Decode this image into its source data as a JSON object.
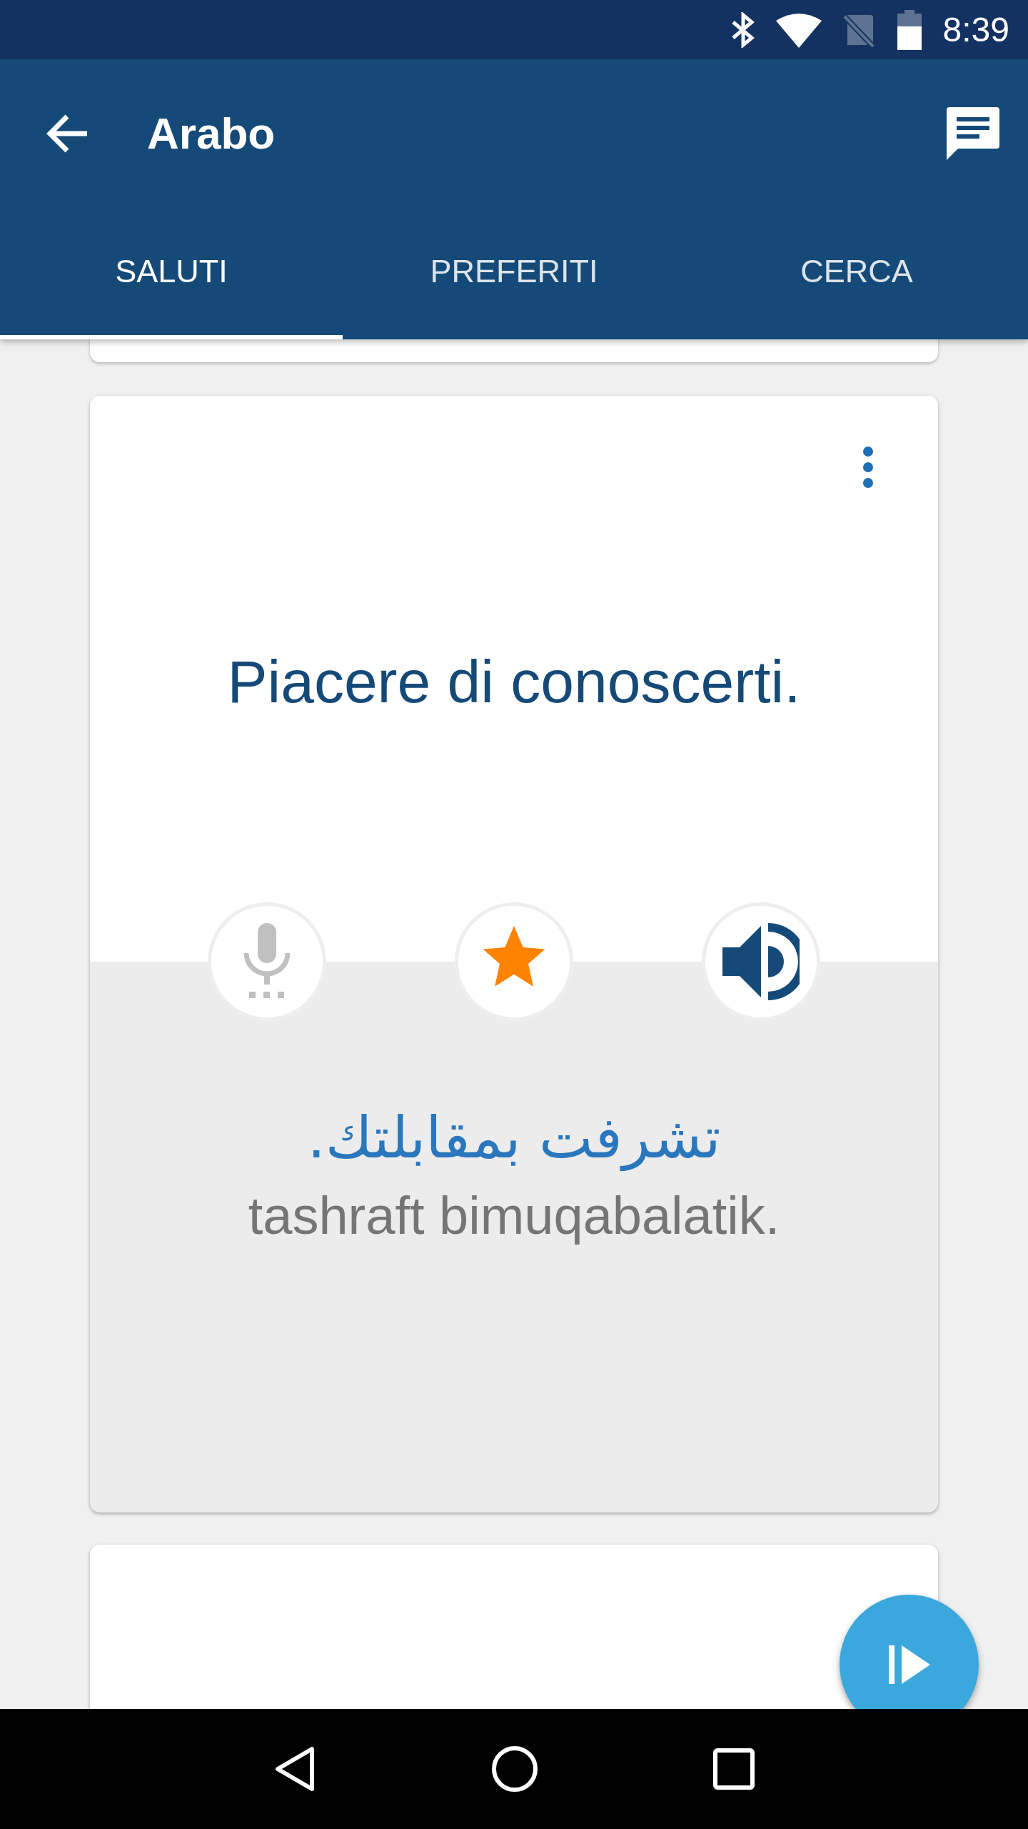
{
  "status_bar": {
    "time": "8:39"
  },
  "app_bar": {
    "title": "Arabo"
  },
  "tabs": [
    {
      "label": "SALUTI",
      "selected": true
    },
    {
      "label": "PREFERITI",
      "selected": false
    },
    {
      "label": "CERCA",
      "selected": false
    }
  ],
  "phrase_card": {
    "phrase": "Piacere di conoscerti.",
    "translation": "تشرفت بمقابلتك.",
    "transliteration": "tashraft bimuqabalatik.",
    "actions": [
      {
        "kind": "mic",
        "disabled": true
      },
      {
        "kind": "star",
        "selected": true
      },
      {
        "kind": "speaker",
        "disabled": false
      }
    ]
  }
}
